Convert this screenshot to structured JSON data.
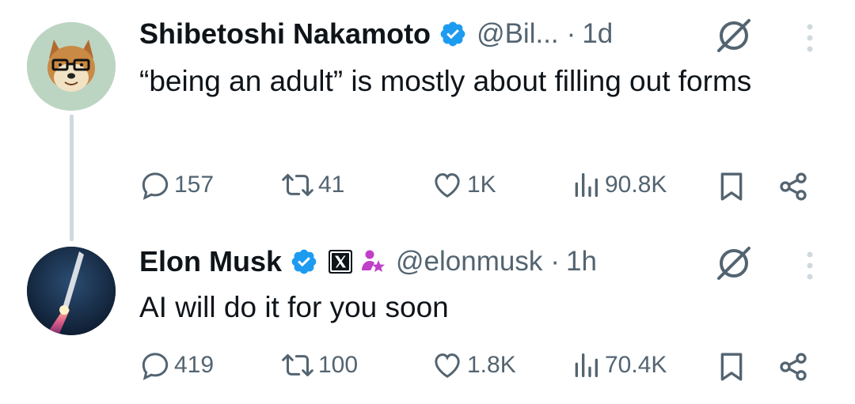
{
  "tweets": [
    {
      "name": "Shibetoshi Nakamoto",
      "handle": "@Bil...",
      "dot": "·",
      "time": "1d",
      "text": "“being an adult” is mostly about filling out forms",
      "replies": "157",
      "reposts": "41",
      "likes": "1K",
      "views": "90.8K",
      "avatar_icon": "doge-avatar",
      "verified_icon": "verified-badge-icon"
    },
    {
      "name": "Elon Musk",
      "handle": "@elonmusk",
      "dot": "·",
      "time": "1h",
      "text": "AI will do it for you soon",
      "replies": "419",
      "reposts": "100",
      "likes": "1.8K",
      "views": "70.4K",
      "avatar_icon": "rocket-launch-avatar",
      "verified_icon": "verified-badge-icon",
      "affiliate_icon": "x-logo-icon",
      "extra_badge_icon": "government-person-icon"
    }
  ],
  "colors": {
    "accent": "#1d9bf0",
    "text": "#0f1419",
    "secondary": "#536471",
    "thread_line": "#cfd9de",
    "badge_purple": "#c03fc8"
  }
}
